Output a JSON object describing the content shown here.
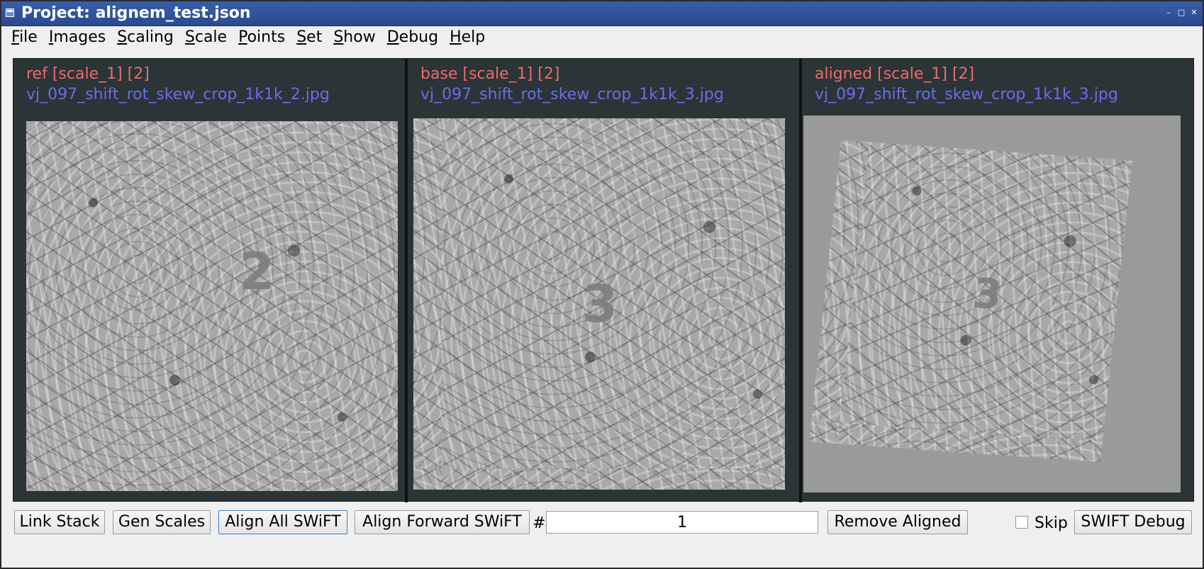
{
  "window": {
    "title": "Project: alignem_test.json"
  },
  "menu": {
    "items": [
      {
        "label": "File",
        "mnemonic": "F",
        "rest": "ile"
      },
      {
        "label": "Images",
        "mnemonic": "I",
        "rest": "mages"
      },
      {
        "label": "Scaling",
        "mnemonic": "S",
        "rest": "caling"
      },
      {
        "label": "Scale",
        "mnemonic": "S",
        "rest": "cale"
      },
      {
        "label": "Points",
        "mnemonic": "P",
        "rest": "oints"
      },
      {
        "label": "Set",
        "mnemonic": "S",
        "rest": "et"
      },
      {
        "label": "Show",
        "mnemonic": "S",
        "rest": "how"
      },
      {
        "label": "Debug",
        "mnemonic": "D",
        "rest": "ebug"
      },
      {
        "label": "Help",
        "mnemonic": "H",
        "rest": "elp"
      }
    ]
  },
  "panels": [
    {
      "role": "ref [scale_1] [2]",
      "filename": "vj_097_shift_rot_skew_crop_1k1k_2.jpg",
      "digit": "2"
    },
    {
      "role": "base [scale_1] [2]",
      "filename": "vj_097_shift_rot_skew_crop_1k1k_3.jpg",
      "digit": "3"
    },
    {
      "role": "aligned [scale_1] [2]",
      "filename": "vj_097_shift_rot_skew_crop_1k1k_3.jpg",
      "digit": "3"
    }
  ],
  "toolbar": {
    "link_stack": "Link Stack",
    "gen_scales": "Gen Scales",
    "align_all": "Align All SWiFT",
    "align_forward": "Align Forward SWiFT",
    "hash": "#",
    "count_value": "1",
    "remove_aligned": "Remove Aligned",
    "skip_label": "Skip",
    "skip_checked": false,
    "swift_debug": "SWIFT Debug"
  },
  "colors": {
    "label_red": "#ef6a6a",
    "label_blue": "#6a6ee6",
    "viewer_bg": "#2b3437",
    "titlebar": "#2a4a90"
  }
}
